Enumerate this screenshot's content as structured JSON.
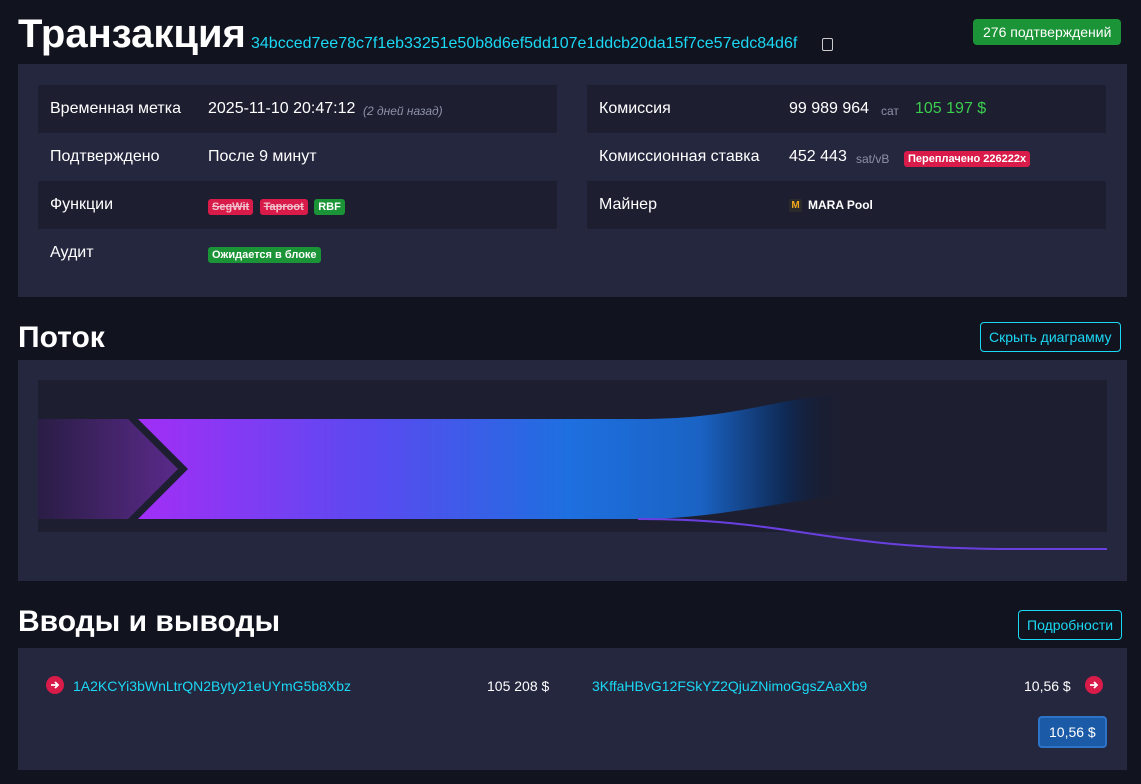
{
  "header": {
    "title": "Транзакция",
    "txid": "34bcced7ee78c7f1eb33251e50b8d6ef5dd107e1ddcb20da15f7ce57edc84d6f",
    "confirmations": "276 подтверждений"
  },
  "details": {
    "timestamp_label": "Временная метка",
    "timestamp_value": "2025-11-10 20:47:12",
    "timestamp_ago": "(2 дней назад)",
    "confirmed_label": "Подтверждено",
    "confirmed_value": "После 9 минут",
    "features_label": "Функции",
    "features": [
      "SegWit",
      "Taproot",
      "RBF"
    ],
    "audit_label": "Аудит",
    "audit_value": "Ожидается в блоке",
    "fee_label": "Комиссия",
    "fee_sat": "99 989 964",
    "fee_unit": "сат",
    "fee_usd": "105 197 $",
    "feerate_label": "Комиссионная ставка",
    "feerate_value": "452 443",
    "feerate_unit": "sat/vB",
    "overpaid": "Переплачено 226222x",
    "miner_label": "Майнер",
    "miner_icon_letter": "M",
    "miner_value": "MARA Pool"
  },
  "flow": {
    "title": "Поток",
    "hide_button": "Скрыть диаграмму"
  },
  "io": {
    "title": "Вводы и выводы",
    "details_button": "Подробности",
    "input_address": "1A2KCYi3bWnLtrQN2Byty21eUYmG5b8Xbz",
    "input_amount": "105 208 $",
    "output_address": "3KffaHBvG12FSkYZ2QjuZNimoGgsZAaXb9",
    "output_amount": "10,56 $",
    "total": "10,56 $"
  },
  "colors": {
    "accent": "#1bd8f4",
    "green": "#1a9436",
    "red": "#d81b48",
    "flow_purple": "#9b2cf5",
    "flow_blue": "#1a6fd0"
  }
}
